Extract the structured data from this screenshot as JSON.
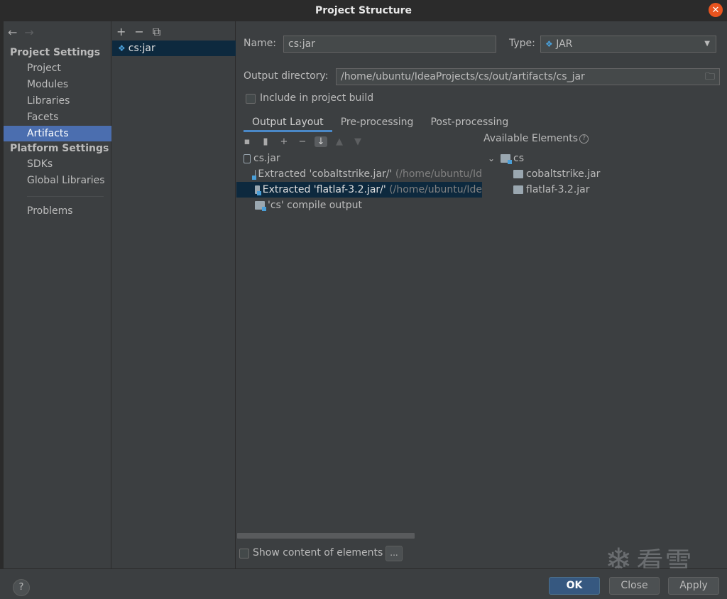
{
  "window": {
    "title": "Project Structure",
    "close_glyph": "✕"
  },
  "nav": {
    "back_glyph": "←",
    "forward_glyph": "→",
    "project_settings_header": "Project Settings",
    "platform_settings_header": "Platform Settings",
    "items": [
      {
        "label": "Project"
      },
      {
        "label": "Modules"
      },
      {
        "label": "Libraries"
      },
      {
        "label": "Facets"
      },
      {
        "label": "Artifacts",
        "selected": true
      },
      {
        "label": "SDKs"
      },
      {
        "label": "Global Libraries"
      },
      {
        "label": "Problems"
      }
    ]
  },
  "artifacts": {
    "toolbar": {
      "add": "+",
      "remove": "−",
      "copy": "⧉"
    },
    "list": [
      {
        "label": "cs:jar",
        "icon": "jar-artifact-icon"
      }
    ]
  },
  "form": {
    "name_label": "Name:",
    "name_value": "cs:jar",
    "type_label": "Type:",
    "type_value": "JAR",
    "output_dir_label": "Output directory:",
    "output_dir_value": "/home/ubuntu/IdeaProjects/cs/out/artifacts/cs_jar",
    "include_build_label": "Include in project build"
  },
  "tabs": [
    {
      "label": "Output Layout",
      "active": true
    },
    {
      "label": "Pre-processing"
    },
    {
      "label": "Post-processing"
    }
  ],
  "layout_toolbar": {
    "new_dir": "▪",
    "new_archive": "▮",
    "add": "+",
    "remove": "−",
    "sort": "↓",
    "up": "▲",
    "down": "▼"
  },
  "output_tree": [
    {
      "label": "cs.jar",
      "path": "",
      "icon": "jar-icon"
    },
    {
      "label": "Extracted 'cobaltstrike.jar/'",
      "path": "(/home/ubuntu/Id",
      "icon": "extracted-icon"
    },
    {
      "label": "Extracted 'flatlaf-3.2.jar/'",
      "path": "(/home/ubuntu/Ide",
      "icon": "extracted-icon",
      "selected": true
    },
    {
      "label": "'cs' compile output",
      "path": "",
      "icon": "module-output-icon"
    }
  ],
  "available": {
    "title": "Available Elements",
    "help_glyph": "?",
    "tree": [
      {
        "label": "cs",
        "expander": "⌄"
      },
      {
        "label": "cobaltstrike.jar"
      },
      {
        "label": "flatlaf-3.2.jar"
      }
    ]
  },
  "show_content_label": "Show content of elements",
  "dots_label": "...",
  "watermark": {
    "text": "看雪",
    "snow_glyph": "❄"
  },
  "buttons": {
    "help": "?",
    "ok": "OK",
    "close": "Close",
    "apply": "Apply"
  },
  "colors": {
    "selection": "#4b6eaf",
    "tree_selection": "#0d293e",
    "accent": "#4a88c7",
    "close_button": "#e9541f"
  }
}
